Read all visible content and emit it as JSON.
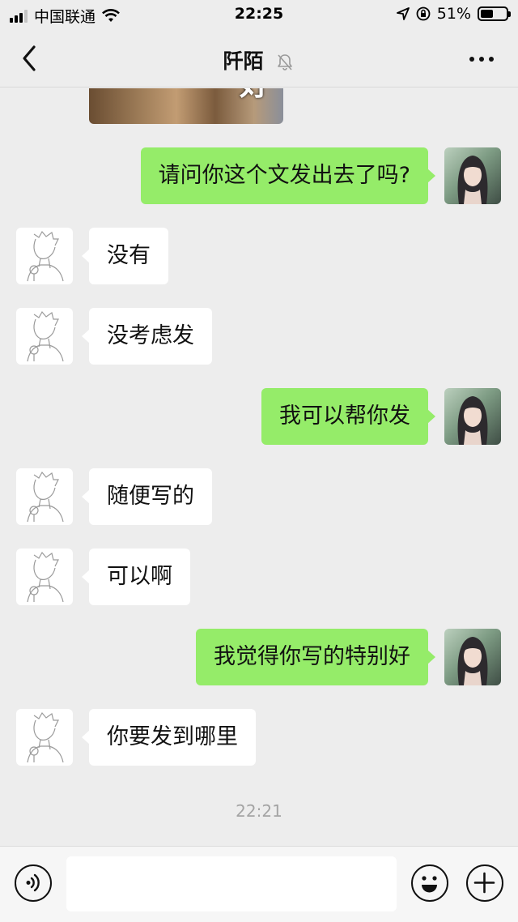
{
  "status_bar": {
    "carrier": "中国联通",
    "time": "22:25",
    "battery_percent": "51%",
    "battery_level": 0.51,
    "icons": [
      "signal-icon",
      "wifi-icon",
      "location-icon",
      "orientation-lock-icon",
      "battery-icon"
    ]
  },
  "navbar": {
    "title": "阡陌",
    "icons": [
      "back-icon",
      "mute-icon",
      "more-icon"
    ]
  },
  "sticker": {
    "text": "好"
  },
  "messages": [
    {
      "from": "me",
      "text": "请问你这个文发出去了吗?"
    },
    {
      "from": "them",
      "text": "没有"
    },
    {
      "from": "them",
      "text": "没考虑发"
    },
    {
      "from": "me",
      "text": "我可以帮你发"
    },
    {
      "from": "them",
      "text": "随便写的"
    },
    {
      "from": "them",
      "text": "可以啊"
    },
    {
      "from": "me",
      "text": "我觉得你写的特别好"
    },
    {
      "from": "them",
      "text": "你要发到哪里"
    }
  ],
  "timestamp": "22:21",
  "input_bar": {
    "text_value": "",
    "icons": [
      "voice-icon",
      "emoji-icon",
      "plus-icon"
    ]
  },
  "colors": {
    "background": "#ededed",
    "my_bubble": "#95ec69",
    "their_bubble": "#ffffff",
    "timestamp": "#a4a4a4"
  }
}
